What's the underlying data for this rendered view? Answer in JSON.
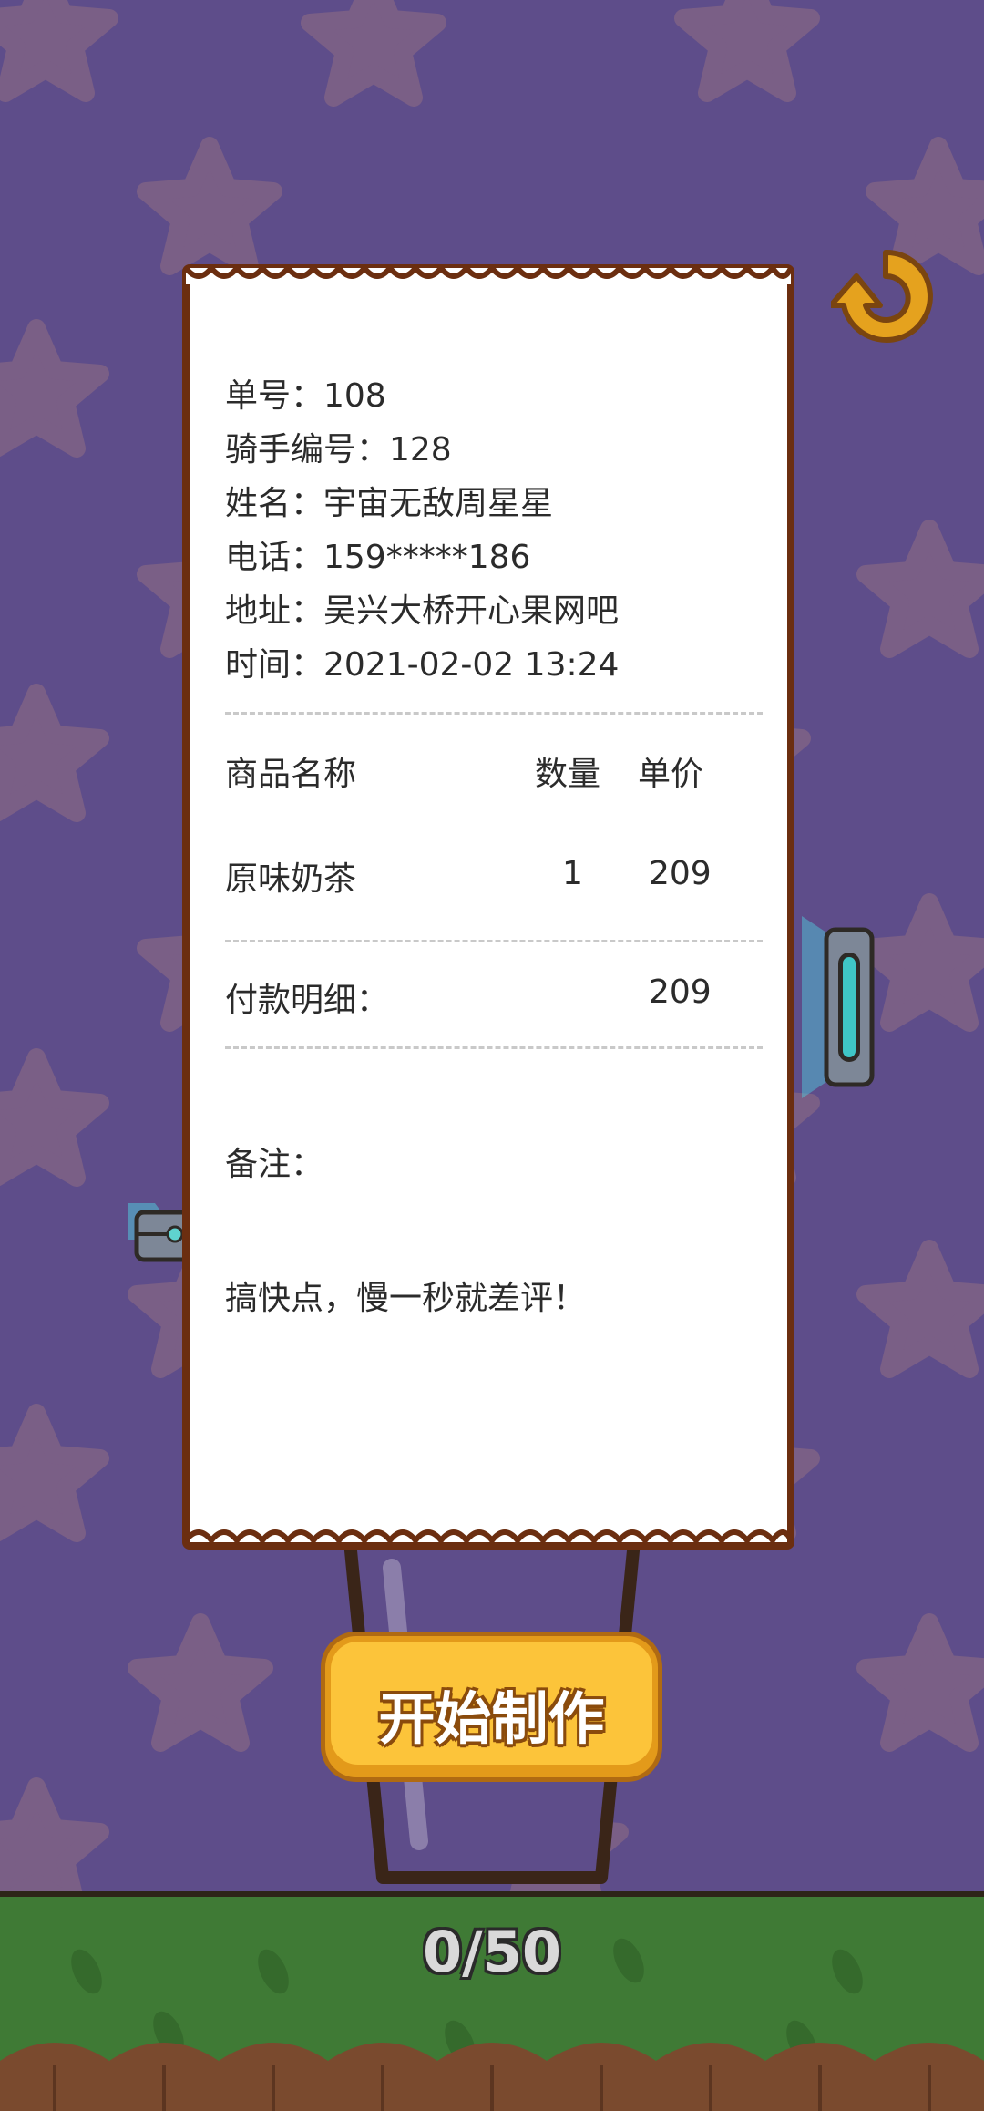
{
  "receipt": {
    "order_no": "单号：108",
    "rider_no": "骑手编号：128",
    "name": "姓名：宇宙无敌周星星",
    "phone": "电话：159*****186",
    "address": "地址：吴兴大桥开心果网吧",
    "time": "时间：2021-02-02 13:24",
    "columns": {
      "name": "商品名称",
      "qty": "数量",
      "price": "单价"
    },
    "items": [
      {
        "name": "原味奶茶",
        "qty": "1",
        "price": "209"
      }
    ],
    "payment_label": "付款明细：",
    "payment_total": "209",
    "remark_label": "备注：",
    "remark_text": "搞快点，慢一秒就差评！"
  },
  "start_button": {
    "label": "开始制作"
  },
  "progress": {
    "text": "0/50",
    "current": 0,
    "total": 50
  },
  "icons": {
    "refresh": "refresh-icon"
  },
  "colors": {
    "background": "#5e4d8a",
    "star": "#7a5f86",
    "ground": "#3f7a35",
    "button": "#fcc43a",
    "refresh": "#e5a21e"
  }
}
